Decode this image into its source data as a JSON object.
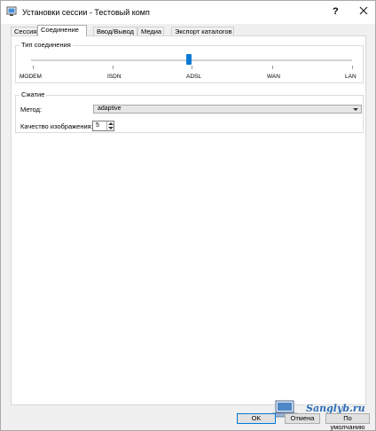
{
  "window": {
    "title": "Установки сессии - Тестовый комп",
    "help_symbol": "?"
  },
  "tabs": [
    {
      "label": "Сессия",
      "active": false
    },
    {
      "label": "Соединение",
      "active": true
    },
    {
      "label": "Ввод/Вывод",
      "active": false
    },
    {
      "label": "Медиа",
      "active": false
    },
    {
      "label": "Экспорт каталогов",
      "active": false
    }
  ],
  "connection_type": {
    "title": "Тип соединения",
    "options": [
      "MODEM",
      "ISDN",
      "ADSL",
      "WAN",
      "LAN"
    ],
    "selected_index": 2
  },
  "compression": {
    "title": "Сжатие",
    "method_label": "Метод:",
    "method_value": "adaptive",
    "quality_label": "Качество изображения:",
    "quality_value": "5"
  },
  "buttons": {
    "ok": "OK",
    "cancel": "Отмена",
    "defaults": "По умолчанию"
  },
  "watermark": {
    "text": "Sanglyb.ru"
  },
  "colors": {
    "accent": "#0a7ad5",
    "watermark": "#2f6fb6"
  }
}
